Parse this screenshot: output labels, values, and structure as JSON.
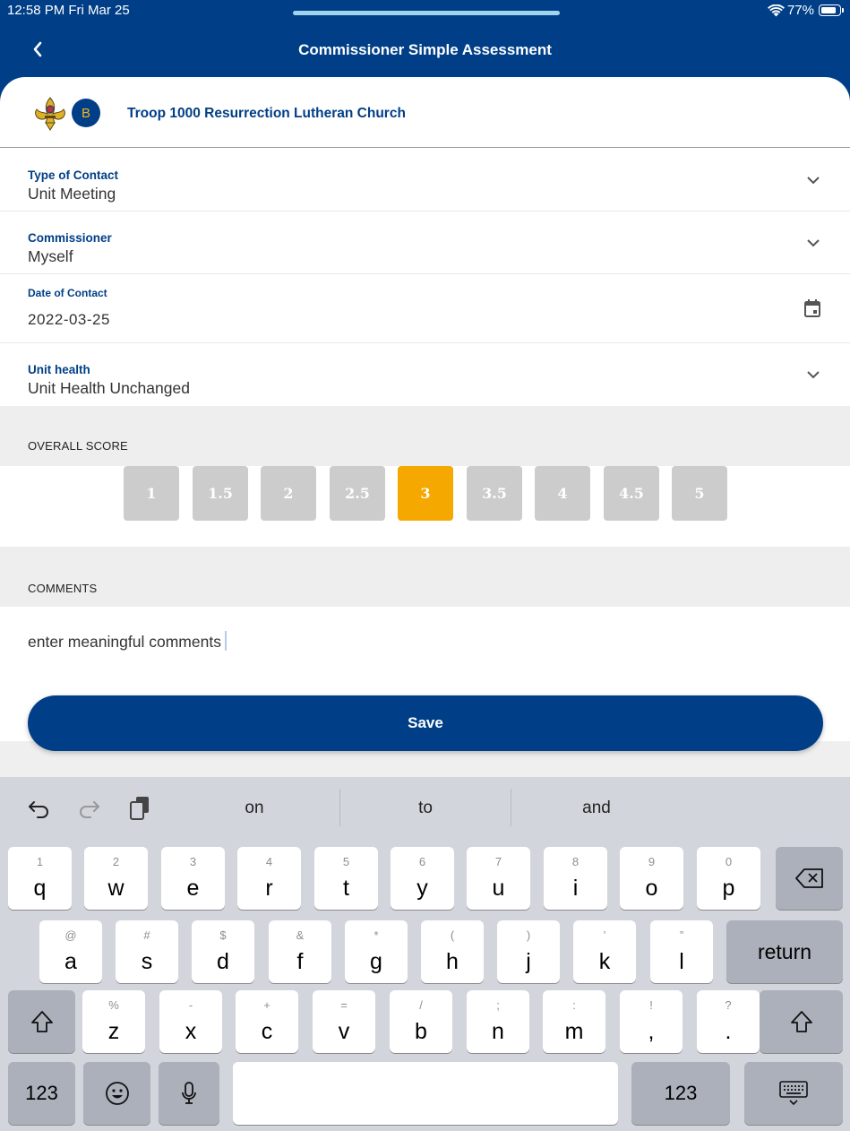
{
  "status_bar": {
    "time": "12:58 PM   Fri Mar 25",
    "battery": "77%"
  },
  "nav": {
    "title": "Commissioner Simple Assessment"
  },
  "unit": {
    "badge": "B",
    "name": "Troop 1000 Resurrection Lutheran Church"
  },
  "fields": {
    "type_of_contact": {
      "label": "Type of Contact",
      "value": "Unit Meeting"
    },
    "commissioner": {
      "label": "Commissioner",
      "value": "Myself"
    },
    "date_of_contact": {
      "label": "Date of Contact",
      "value": "2022-03-25"
    },
    "unit_health": {
      "label": "Unit health",
      "value": "Unit Health Unchanged"
    }
  },
  "overall_score": {
    "label": "OVERALL SCORE",
    "options": [
      "1",
      "1.5",
      "2",
      "2.5",
      "3",
      "3.5",
      "4",
      "4.5",
      "5"
    ],
    "selected": "3"
  },
  "comments": {
    "label": "COMMENTS",
    "value": "enter meaningful comments"
  },
  "save_label": "Save",
  "colors": {
    "primary": "#003f87",
    "accent": "#f5a800",
    "unselected": "#cccccc"
  },
  "keyboard": {
    "suggestions": [
      "on",
      "to",
      "and"
    ],
    "row1": [
      [
        "1",
        "q"
      ],
      [
        "2",
        "w"
      ],
      [
        "3",
        "e"
      ],
      [
        "4",
        "r"
      ],
      [
        "5",
        "t"
      ],
      [
        "6",
        "y"
      ],
      [
        "7",
        "u"
      ],
      [
        "8",
        "i"
      ],
      [
        "9",
        "o"
      ],
      [
        "0",
        "p"
      ]
    ],
    "row2": [
      [
        "@",
        "a"
      ],
      [
        "#",
        "s"
      ],
      [
        "$",
        "d"
      ],
      [
        "&",
        "f"
      ],
      [
        "*",
        "g"
      ],
      [
        "(",
        "h"
      ],
      [
        ")",
        "j"
      ],
      [
        "’",
        "k"
      ],
      [
        "”",
        "l"
      ]
    ],
    "row3": [
      [
        "%",
        "z"
      ],
      [
        "-",
        "x"
      ],
      [
        "+",
        "c"
      ],
      [
        "=",
        "v"
      ],
      [
        "/",
        "b"
      ],
      [
        ";",
        "n"
      ],
      [
        ":",
        "m"
      ],
      [
        "!",
        ","
      ],
      [
        "?",
        "."
      ]
    ],
    "return_label": "return",
    "numbers_label": "123",
    "icons": [
      "undo-icon",
      "redo-icon",
      "clipboard-icon",
      "delete-icon",
      "shift-icon",
      "emoji-icon",
      "microphone-icon",
      "keyboard-dismiss-icon"
    ]
  }
}
